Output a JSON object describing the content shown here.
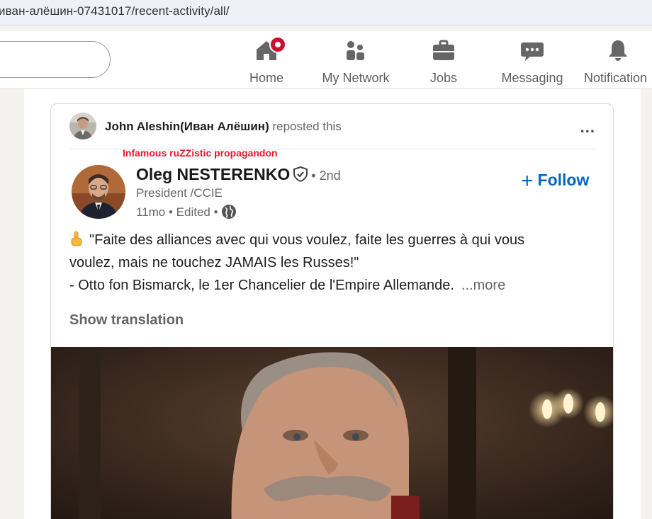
{
  "browser": {
    "url": "иван-алёшин-07431017/recent-activity/all/"
  },
  "nav": {
    "items": [
      {
        "label": "Home",
        "icon": "home-icon"
      },
      {
        "label": "My Network",
        "icon": "network-icon"
      },
      {
        "label": "Jobs",
        "icon": "briefcase-icon"
      },
      {
        "label": "Messaging",
        "icon": "messaging-icon"
      },
      {
        "label": "Notification",
        "icon": "bell-icon"
      }
    ]
  },
  "post": {
    "repost": {
      "name": "John Aleshin(Иван Алёшин)",
      "suffix": "reposted this",
      "menu": "..."
    },
    "annotation": "Infamous ruZZistic propagandon",
    "author": {
      "name": "Oleg NESTERENKO",
      "degree": "• 2nd",
      "headline": "President /CCIE",
      "meta": "11mo • Edited •"
    },
    "follow": {
      "plus": "+",
      "label": "Follow"
    },
    "text": {
      "line1": "\"Faite des alliances avec qui vous voulez, faite les guerres à qui vous",
      "line2": "voulez, mais ne touchez JAMAIS les Russes!\"",
      "line3": "- Otto fon Bismarck, le 1er Chancelier de l'Empire Allemande.",
      "more": "...more"
    },
    "translate": "Show translation"
  },
  "colors": {
    "accent": "#0a66c2",
    "annotation": "#e21b2d",
    "badge": "#cb112d"
  }
}
